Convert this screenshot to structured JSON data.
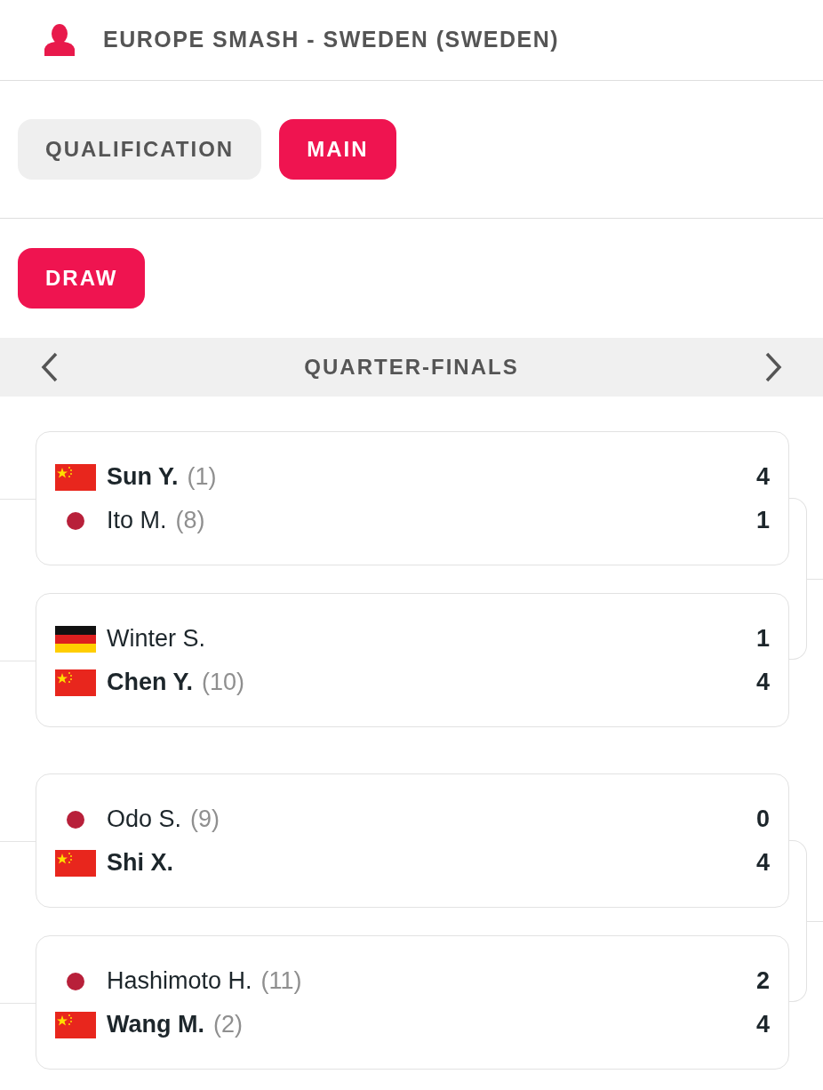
{
  "header": {
    "title": "EUROPE SMASH - SWEDEN (SWEDEN)"
  },
  "stage_tabs": [
    {
      "label": "QUALIFICATION",
      "selected": false
    },
    {
      "label": "MAIN",
      "selected": true
    }
  ],
  "view_tabs": [
    {
      "label": "DRAW",
      "selected": true
    }
  ],
  "round": {
    "title": "QUARTER-FINALS"
  },
  "pairs": [
    {
      "matches": [
        {
          "players": [
            {
              "kind": "cn",
              "name": "Sun Y.",
              "seed": "(1)",
              "score": "4",
              "winner": true
            },
            {
              "kind": "jp",
              "name": "Ito M.",
              "seed": "(8)",
              "score": "1",
              "winner": false
            }
          ]
        },
        {
          "players": [
            {
              "kind": "de",
              "name": "Winter S.",
              "score": "1",
              "winner": false
            },
            {
              "kind": "cn",
              "name": "Chen Y.",
              "seed": "(10)",
              "score": "4",
              "winner": true
            }
          ]
        }
      ]
    },
    {
      "matches": [
        {
          "players": [
            {
              "kind": "jp",
              "name": "Odo S.",
              "seed": "(9)",
              "score": "0",
              "winner": false
            },
            {
              "kind": "cn",
              "name": "Shi X.",
              "score": "4",
              "winner": true
            }
          ]
        },
        {
          "players": [
            {
              "kind": "jp",
              "name": "Hashimoto H.",
              "seed": "(11)",
              "score": "2",
              "winner": false
            },
            {
              "kind": "cn",
              "name": "Wang M.",
              "seed": "(2)",
              "score": "4",
              "winner": true
            }
          ]
        }
      ]
    }
  ]
}
